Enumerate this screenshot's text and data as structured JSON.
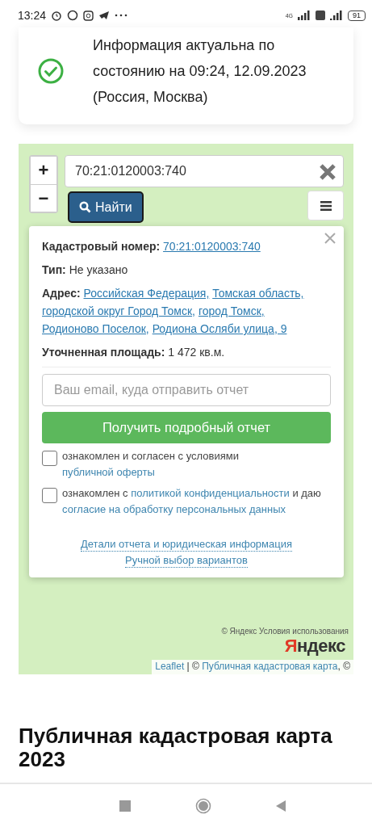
{
  "status_bar": {
    "time": "13:24",
    "network": "4G",
    "battery": "91"
  },
  "notice": {
    "text": "Информация актуальна по состоянию на 09:24, 12.09.2023 (Россия, Москва)"
  },
  "map": {
    "zoom_in": "+",
    "zoom_out": "−",
    "search": {
      "value": "70:21:0120003:740"
    },
    "find_button": "Найти",
    "popup": {
      "fields": [
        {
          "label": "Кадастровый номер:",
          "values": [
            "70:21:0120003:740"
          ],
          "kind": "link"
        },
        {
          "label": "Тип:",
          "values": [
            "Не указано"
          ],
          "kind": "text"
        },
        {
          "label": "Адрес:",
          "values": [
            "Российская Федерация,",
            "Томская область,",
            "городской округ Город Томск,",
            "город Томск,",
            "Родионово Поселок,",
            "Родиона Осляби улица, 9"
          ],
          "kind": "link"
        },
        {
          "label": "Уточненная площадь:",
          "values": [
            "1 472 кв.м."
          ],
          "kind": "text"
        }
      ],
      "email": {
        "placeholder": "Ваш email, куда отправить отчет"
      },
      "submit": "Получить подробный отчет",
      "agreements": [
        {
          "checked": false,
          "parts": [
            {
              "text": "ознакомлен и согласен с условиями ",
              "kind": "text"
            },
            {
              "text": "публичной оферты",
              "kind": "link"
            }
          ]
        },
        {
          "checked": false,
          "parts": [
            {
              "text": "ознакомлен с ",
              "kind": "text"
            },
            {
              "text": "политикой конфиденциальности",
              "kind": "link"
            },
            {
              "text": " и даю ",
              "kind": "text"
            },
            {
              "text": "согласие на обработку персональных данных",
              "kind": "link"
            }
          ]
        }
      ],
      "links": [
        "Детали отчета и юридическая информация",
        "Ручной выбор вариантов"
      ]
    },
    "logo": "Яндекс",
    "attribution_yandex": "© Яндекс Условия использования",
    "attribution": [
      {
        "text": "Leaflet",
        "kind": "link"
      },
      {
        "text": " | © ",
        "kind": "text"
      },
      {
        "text": "Публичная кадастровая карта",
        "kind": "link"
      },
      {
        "text": ", ©",
        "kind": "text"
      }
    ]
  },
  "heading": "Публичная кадастровая карта 2023"
}
